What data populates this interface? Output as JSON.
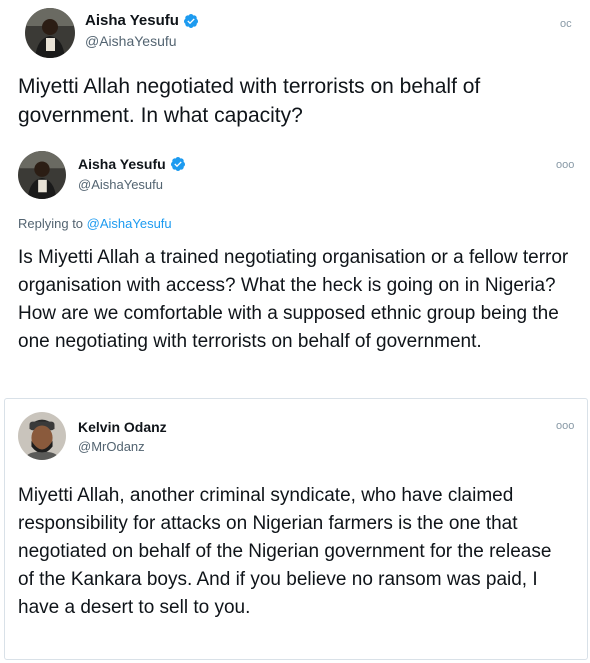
{
  "tweets": [
    {
      "name": "Aisha Yesufu",
      "handle": "@AishaYesufu",
      "verified": true,
      "more_label": "oc",
      "text": "Miyetti Allah negotiated with terrorists on behalf of government. In what capacity?"
    },
    {
      "name": "Aisha Yesufu",
      "handle": "@AishaYesufu",
      "verified": true,
      "more_label": "ooo",
      "replying_prefix": "Replying to ",
      "replying_to": "@AishaYesufu",
      "text": "Is Miyetti Allah a trained negotiating organisation or a fellow terror organisation with access? What the heck is going on in Nigeria? How are we comfortable with a supposed ethnic group being the one negotiating with terrorists on behalf of government."
    },
    {
      "name": "Kelvin Odanz",
      "handle": "@MrOdanz",
      "verified": false,
      "more_label": "ooo",
      "text": "Miyetti Allah, another criminal syndicate, who have claimed responsibility for attacks on Nigerian farmers is the one that negotiated on behalf of the Nigerian government for the release of the Kankara boys. And if you believe no ransom was paid, I have a desert to sell to you."
    }
  ],
  "colors": {
    "verified_badge": "#1d9bf0",
    "handle": "#536471",
    "link": "#1d9bf0",
    "text": "#0f1419"
  },
  "icons": [
    "verified-badge-icon",
    "more-options-icon"
  ]
}
